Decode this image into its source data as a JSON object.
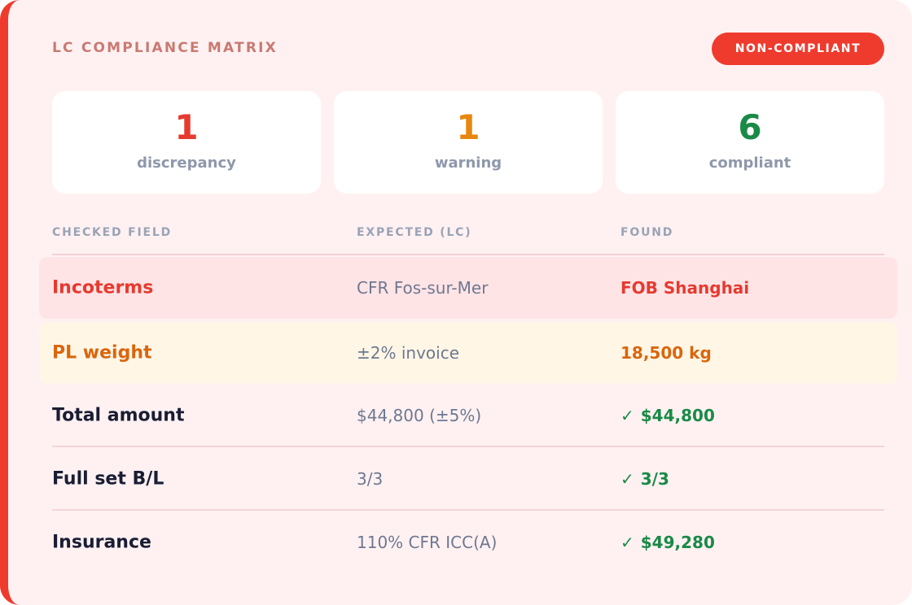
{
  "header": {
    "title": "LC COMPLIANCE MATRIX",
    "status_badge": "NON-COMPLIANT"
  },
  "summary": [
    {
      "count": "1",
      "label": "discrepancy",
      "color": "#e63a2f"
    },
    {
      "count": "1",
      "label": "warning",
      "color": "#e8870f"
    },
    {
      "count": "6",
      "label": "compliant",
      "color": "#1a8a47"
    }
  ],
  "table": {
    "columns": [
      "CHECKED FIELD",
      "EXPECTED (LC)",
      "FOUND"
    ],
    "rows": [
      {
        "field": "Incoterms",
        "expected": "CFR Fos-sur-Mer",
        "found": "FOB Shanghai",
        "status": "discrepancy",
        "color": "#e63a2f"
      },
      {
        "field": "PL weight",
        "expected": "±2% invoice",
        "found": "18,500 kg",
        "status": "warning",
        "color": "#d9660e"
      },
      {
        "field": "Total amount",
        "expected": "$44,800 (±5%)",
        "found": "$44,800",
        "status": "compliant",
        "color": "#1a8a47"
      },
      {
        "field": "Full set B/L",
        "expected": "3/3",
        "found": "3/3",
        "status": "compliant",
        "color": "#1a8a47"
      },
      {
        "field": "Insurance",
        "expected": "110% CFR ICC(A)",
        "found": "$49,280",
        "status": "compliant",
        "color": "#1a8a47"
      }
    ]
  },
  "icons": {
    "compliant": "checkmark-icon"
  },
  "colors": {
    "accent": "#ef3b2d",
    "background": "#fff1f2",
    "discrepancy": "#e63a2f",
    "warning": "#e8870f",
    "compliant": "#1a8a47",
    "text_dark": "#1a1d33",
    "text_muted": "#6e7890"
  }
}
